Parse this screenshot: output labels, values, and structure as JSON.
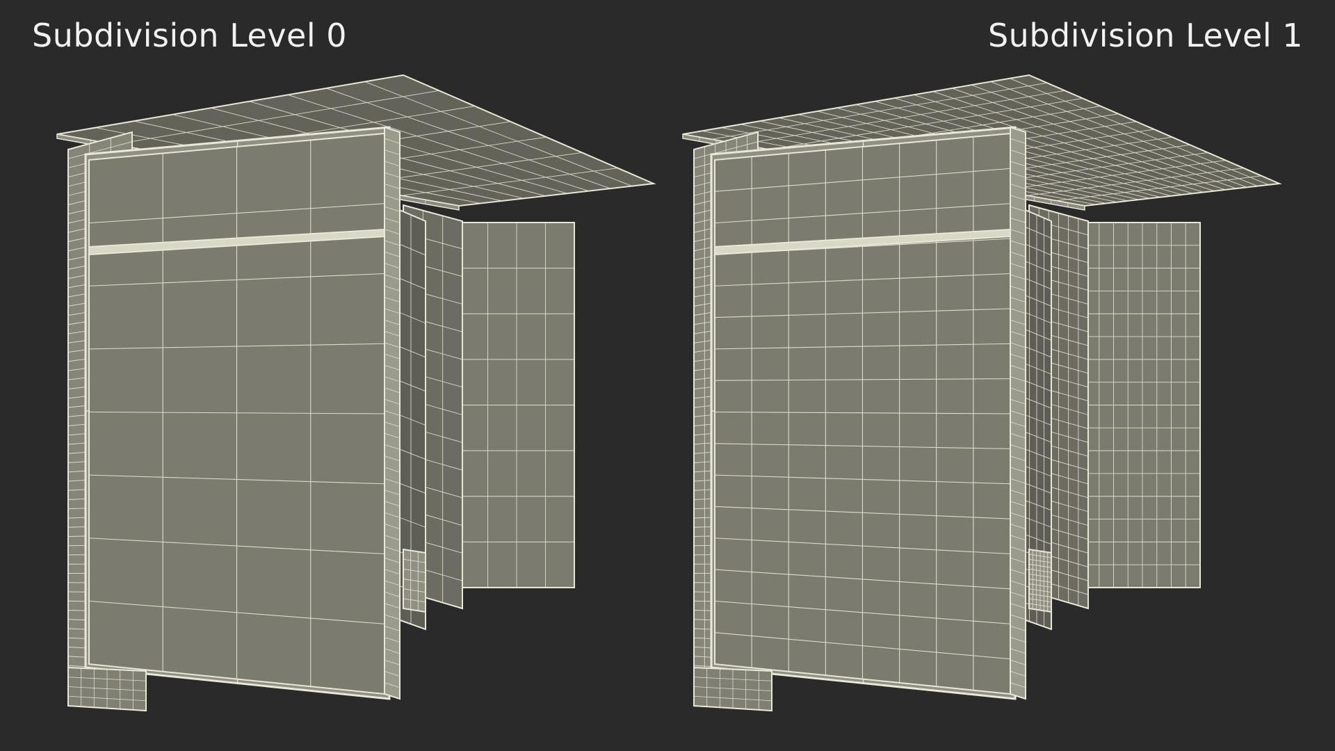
{
  "labels": {
    "left": "Subdivision Level 0",
    "right": "Subdivision Level 1"
  },
  "colors": {
    "background": "#2a2a2a",
    "surface": "#7b7b70",
    "surface_dark": "#63635a",
    "wire": "#e9e7d6",
    "text": "#f2f2f2"
  },
  "views": [
    {
      "name": "level-0",
      "grid_factor": 1
    },
    {
      "name": "level-1",
      "grid_factor": 2
    }
  ]
}
